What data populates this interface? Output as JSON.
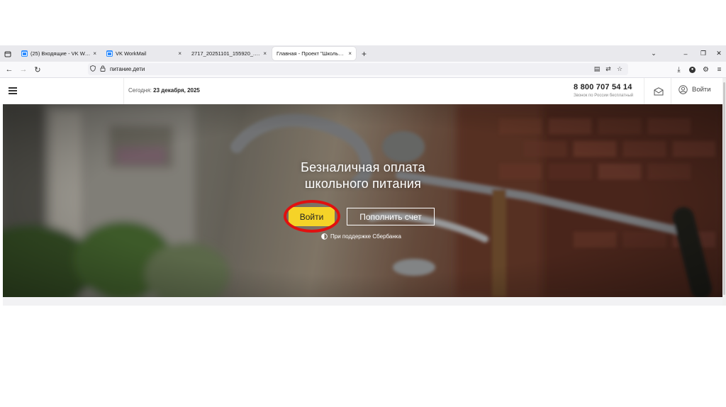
{
  "browser": {
    "tabs": [
      {
        "title": "(25) Входящие - VK WorkMail",
        "has_favicon": true,
        "active": false
      },
      {
        "title": "VK WorkMail",
        "has_favicon": true,
        "active": false
      },
      {
        "title": "2717_20251101_155920_.pdf",
        "has_favicon": false,
        "active": false
      },
      {
        "title": "Главная - Проект \"Школьные пита",
        "has_favicon": false,
        "active": true
      }
    ],
    "new_tab_symbol": "+",
    "close_symbol": "×",
    "url": "питание.дети",
    "window_controls": {
      "minimize": "–",
      "maximize": "❐",
      "close": "✕",
      "tab_list": "⌄"
    },
    "icons": [
      "back-icon",
      "forward-icon",
      "reload-icon",
      "shield-icon",
      "lock-icon",
      "reader-icon",
      "translate-icon",
      "star-icon",
      "download-icon",
      "profile-icon",
      "extensions-icon",
      "menu-icon"
    ]
  },
  "header": {
    "today_label": "Сегодня:",
    "today_date": "23 декабря, 2025",
    "phone": "8 800 707 54 14",
    "phone_note": "Звонок по России бесплатный",
    "login_label": "Войти"
  },
  "hero": {
    "title_line1": "Безналичная оплата",
    "title_line2": "школьного питания",
    "login_button": "Войти",
    "topup_button": "Пополнить счет",
    "sber_note": "При поддержке Сбербанка",
    "highlight_color": "#e01010",
    "login_button_color": "#f5d328"
  }
}
